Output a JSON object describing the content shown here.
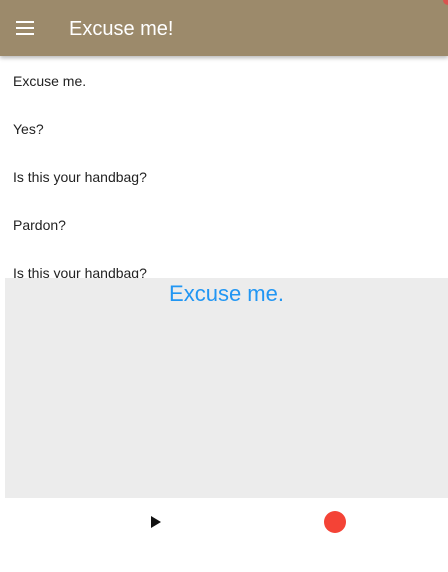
{
  "appbar": {
    "title": "Excuse me!",
    "menu_icon": "menu-icon",
    "background": "#9c8a6b"
  },
  "dialogue": {
    "lines": [
      "Excuse me.",
      "Yes?",
      "Is this your handbag?",
      "Pardon?",
      "Is this your handbag?"
    ]
  },
  "panel": {
    "current_phrase": "Excuse me.",
    "phrase_color": "#2196f3"
  },
  "controls": {
    "play_icon": "play-icon",
    "record_icon": "record-icon",
    "record_color": "#f44336"
  }
}
